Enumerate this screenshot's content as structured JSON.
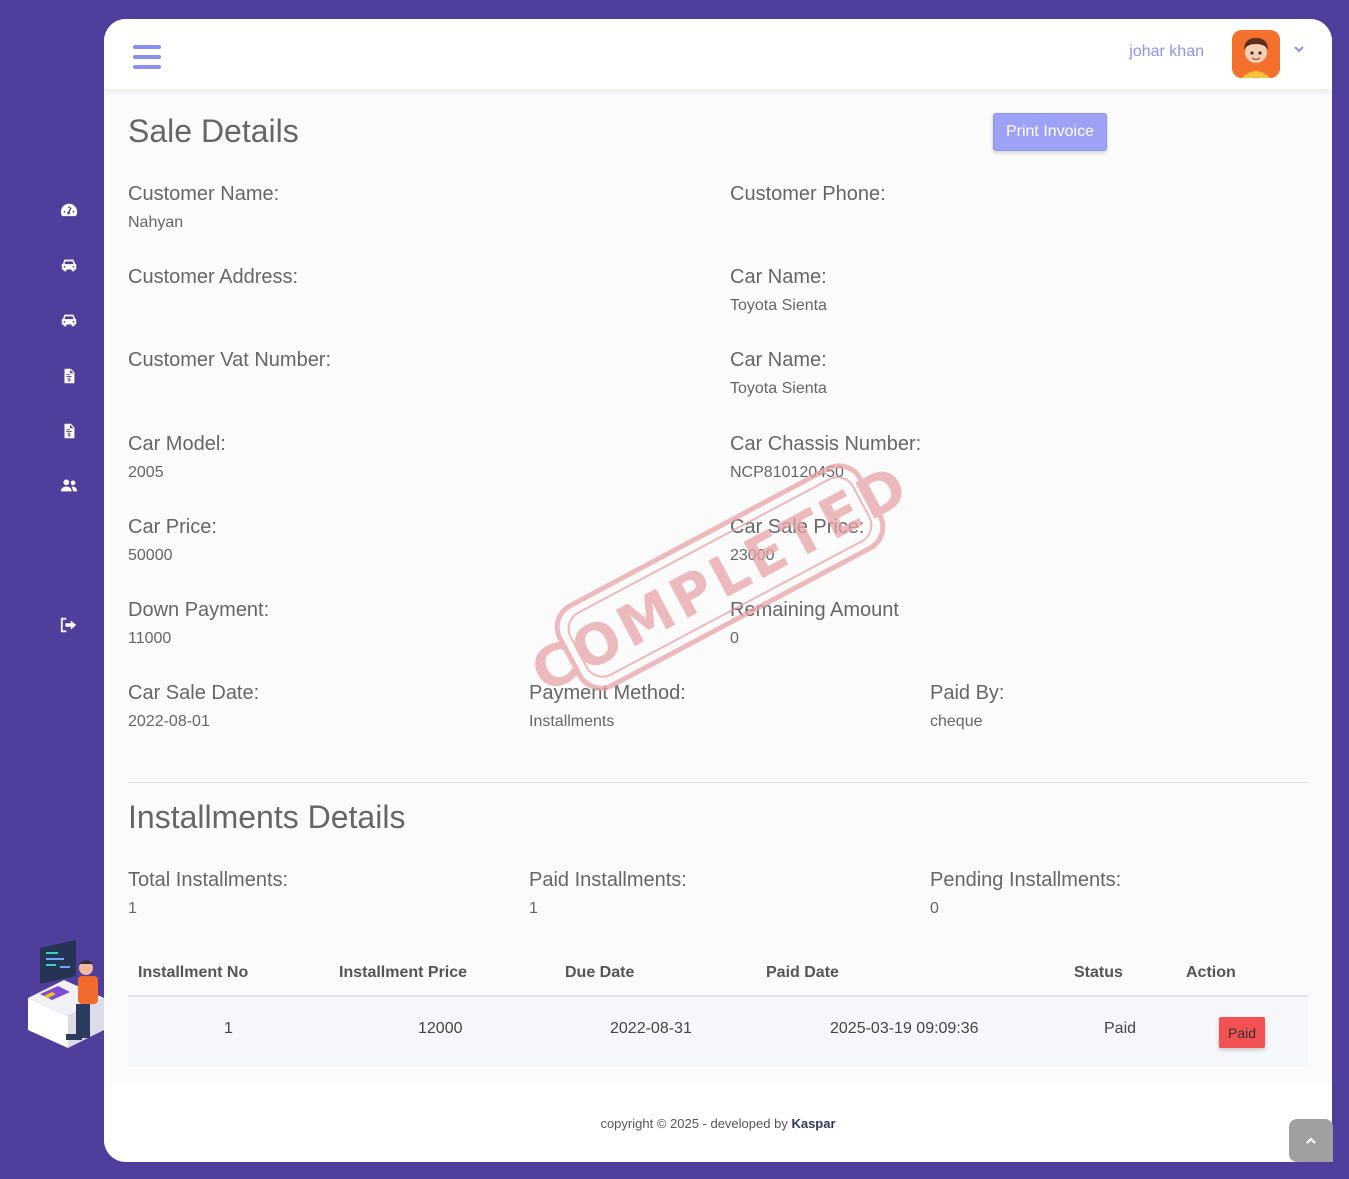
{
  "header": {
    "user_name": "johar khan"
  },
  "sidebar": {
    "items": [
      {
        "icon": "dashboard-icon"
      },
      {
        "icon": "car-icon"
      },
      {
        "icon": "car-icon"
      },
      {
        "icon": "invoice-icon"
      },
      {
        "icon": "invoice-icon"
      },
      {
        "icon": "users-icon"
      },
      {
        "icon": "logout-icon"
      }
    ]
  },
  "sale": {
    "title": "Sale Details",
    "print_label": "Print Invoice",
    "stamp_text": "COMPLETED",
    "customer_name_label": "Customer Name:",
    "customer_name": "Nahyan",
    "customer_phone_label": "Customer Phone:",
    "customer_phone": "",
    "customer_address_label": "Customer Address:",
    "customer_address": "",
    "car_name_label": "Car Name:",
    "car_name": "Toyota Sienta",
    "customer_vat_label": "Customer Vat Number:",
    "customer_vat": "",
    "car_name2_label": "Car Name:",
    "car_name2": "Toyota Sienta",
    "car_model_label": "Car Model:",
    "car_model": "2005",
    "car_chassis_label": "Car Chassis Number:",
    "car_chassis": "NCP810120450",
    "car_price_label": "Car Price:",
    "car_price": "50000",
    "car_sale_price_label": "Car Sale Price:",
    "car_sale_price": "23000",
    "down_payment_label": "Down Payment:",
    "down_payment": "11000",
    "remaining_label": "Remaining Amount",
    "remaining": "0",
    "sale_date_label": "Car Sale Date:",
    "sale_date": "2022-08-01",
    "payment_method_label": "Payment Method:",
    "payment_method": "Installments",
    "paid_by_label": "Paid By:",
    "paid_by": "cheque"
  },
  "installments": {
    "title": "Installments Details",
    "total_label": "Total Installments:",
    "total": "1",
    "paid_label": "Paid Installments:",
    "paid": "1",
    "pending_label": "Pending Installments:",
    "pending": "0",
    "columns": [
      "Installment No",
      "Installment Price",
      "Due Date",
      "Paid Date",
      "Status",
      "Action"
    ],
    "rows": [
      {
        "no": "1",
        "price": "12000",
        "due": "2022-08-31",
        "paid_date": "2025-03-19 09:09:36",
        "status": "Paid",
        "action": "Paid"
      }
    ]
  },
  "footer": {
    "text": "copyright © 2025 - developed by",
    "brand": "Kaspar"
  },
  "colors": {
    "background": "#4f3e9c",
    "accent": "#9ea2f7",
    "danger": "#f25252",
    "stamp": "#e8a4a8"
  }
}
